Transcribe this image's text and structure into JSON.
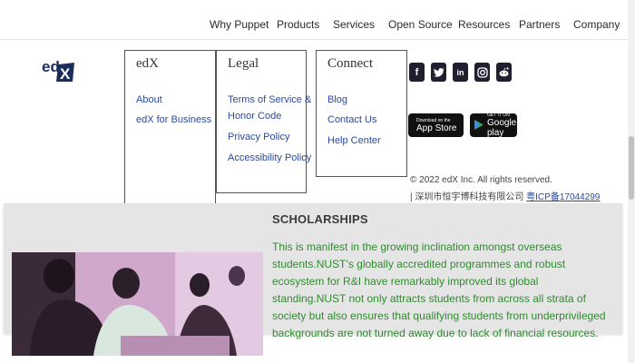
{
  "nav": {
    "items": [
      "Why Puppet",
      "Products",
      "Services",
      "Open Source",
      "Resources",
      "Partners",
      "Company"
    ]
  },
  "footer": {
    "logo_text": "edX",
    "columns": [
      {
        "heading": "edX",
        "links": [
          "About",
          "edX for Business"
        ]
      },
      {
        "heading": "Legal",
        "links": [
          "Terms of Service &",
          "Honor Code",
          "Privacy Policy",
          "Accessibility Policy"
        ]
      },
      {
        "heading": "Connect",
        "links": [
          "Blog",
          "Contact Us",
          "Help Center"
        ]
      }
    ],
    "social_icons": [
      "facebook-icon",
      "twitter-icon",
      "linkedin-icon",
      "instagram-icon",
      "reddit-icon"
    ],
    "app_store": {
      "small": "Download on the",
      "big": "App Store"
    },
    "google_play": {
      "small": "GET IT ON",
      "big": "Google play"
    },
    "copyright": "© 2022 edX Inc. All rights reserved.",
    "icp_text": "| 深圳市恒宇博科技有限公司 ",
    "icp_link": "粤ICP备17044299"
  },
  "card": {
    "title": "SCHOLARSHIPS",
    "body": "This is manifest in the growing inclination amongst overseas students.NUST’s globally accredited programmes and robust ecosystem for R&I have remarkably improved its global standing.NUST not only attracts students from across all strata of society but also ensures that qualifying students from underprivileged backgrounds are not turned away due to lack of financial resources.",
    "text_color": "#2e8b2e"
  }
}
